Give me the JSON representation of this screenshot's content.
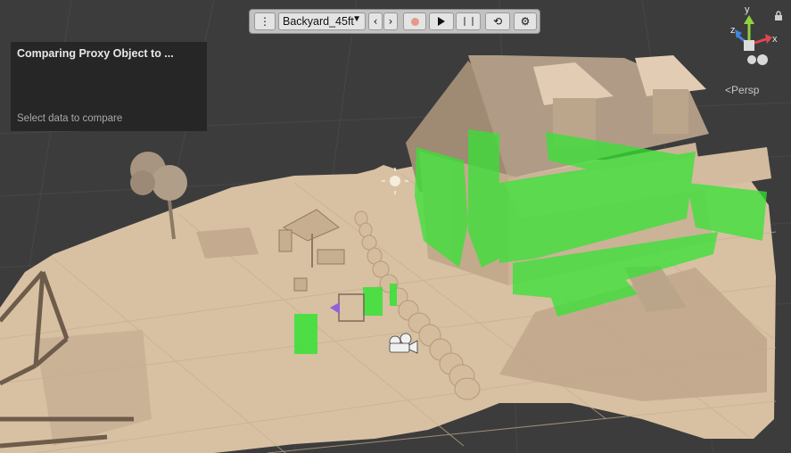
{
  "toolbar": {
    "scene_name": "Backyard_45ft",
    "icons": [
      "kebab-menu-icon",
      "dropdown-arrow-icon",
      "chevron-left-icon",
      "chevron-right-icon",
      "record-icon",
      "play-icon",
      "pause-icon",
      "loop-icon",
      "gear-icon"
    ]
  },
  "panel": {
    "title": "Comparing Proxy Object to ...",
    "hint": "Select data to compare"
  },
  "gizmo": {
    "axis_x": "x",
    "axis_y": "y",
    "axis_z": "z",
    "projection": "Persp"
  },
  "colors": {
    "sky": "#3b3b3b",
    "ground": "#d9c1a4",
    "house": "#cdb395",
    "proxy_highlight": "#35e335",
    "axis_x": "#e0484c",
    "axis_y": "#8dd43c",
    "axis_z": "#3f87e0"
  }
}
